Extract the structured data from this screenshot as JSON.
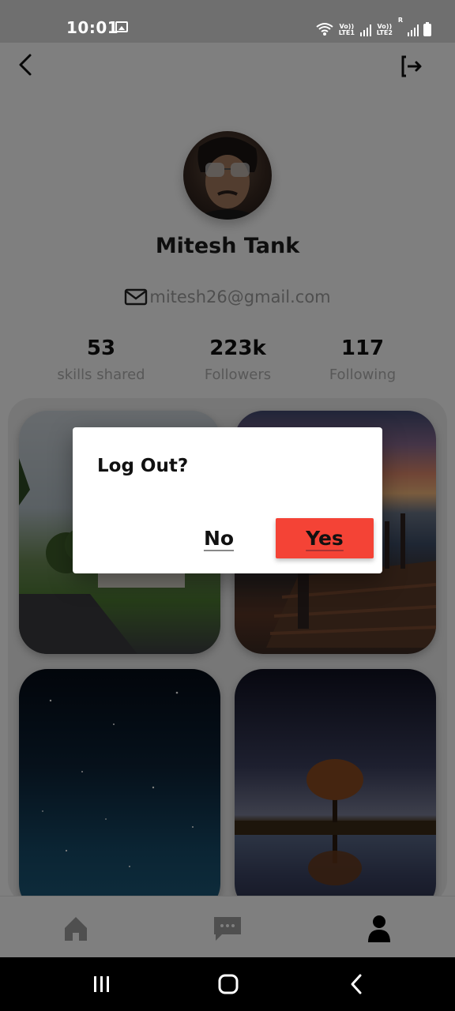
{
  "status_bar": {
    "time": "10:01",
    "sim1_label": "Vo)) LTE1",
    "sim2_label": "Vo)) LTE2",
    "sim2_roaming": "R"
  },
  "profile": {
    "name": "Mitesh Tank",
    "email": "mitesh26@gmail.com",
    "stats": [
      {
        "value": "53",
        "label": "skills shared"
      },
      {
        "value": "223k",
        "label": "Followers"
      },
      {
        "value": "117",
        "label": "Following"
      }
    ]
  },
  "gallery": {
    "items": [
      {
        "subject": "campus lawn and road"
      },
      {
        "subject": "wooden pier at sunset"
      },
      {
        "subject": "starry night sky"
      },
      {
        "subject": "lone tree reflected in water"
      }
    ]
  },
  "bottom_nav": {
    "items": [
      {
        "icon": "home-icon",
        "active": false
      },
      {
        "icon": "chat-icon",
        "active": false
      },
      {
        "icon": "profile-icon",
        "active": true
      }
    ]
  },
  "dialog": {
    "title": "Log Out?",
    "no_label": "No",
    "yes_label": "Yes",
    "yes_color": "#f44336"
  },
  "colors": {
    "accent": "#f44336",
    "text_primary": "#1d1d1d",
    "text_muted": "#b0b0b0"
  }
}
